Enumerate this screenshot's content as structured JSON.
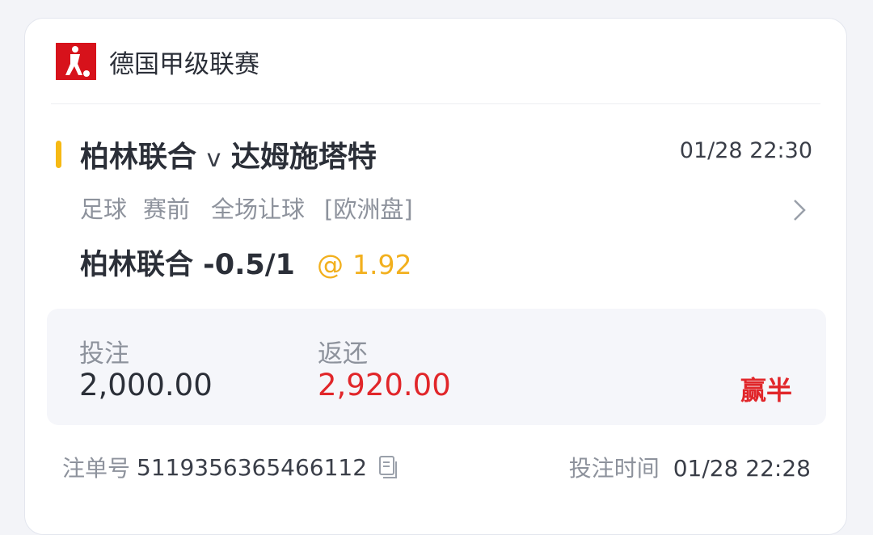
{
  "league": {
    "name": "德国甲级联赛",
    "logo_icon": "bundesliga-logo-icon",
    "logo_color": "#d7121b"
  },
  "match": {
    "home": "柏林联合",
    "vs": "v",
    "away": "达姆施塔特",
    "time": "01/28 22:30",
    "accent_color": "#f6b914"
  },
  "bet": {
    "sport": "足球",
    "stage": "赛前",
    "market": "全场让球",
    "odds_type": "[欧洲盘]",
    "selection": "柏林联合 -0.5/1",
    "odds_prefix": "@",
    "odds": "1.92",
    "odds_color": "#f2b01e"
  },
  "stake": {
    "stake_label": "投注",
    "stake_value": "2,000.00",
    "return_label": "返还",
    "return_value": "2,920.00",
    "return_color": "#e1262a",
    "result": "赢半"
  },
  "footer": {
    "order_label": "注单号",
    "order_number": "5119356365466112",
    "copy_icon": "copy-icon",
    "bet_time_label": "投注时间",
    "bet_time": "01/28 22:28"
  }
}
